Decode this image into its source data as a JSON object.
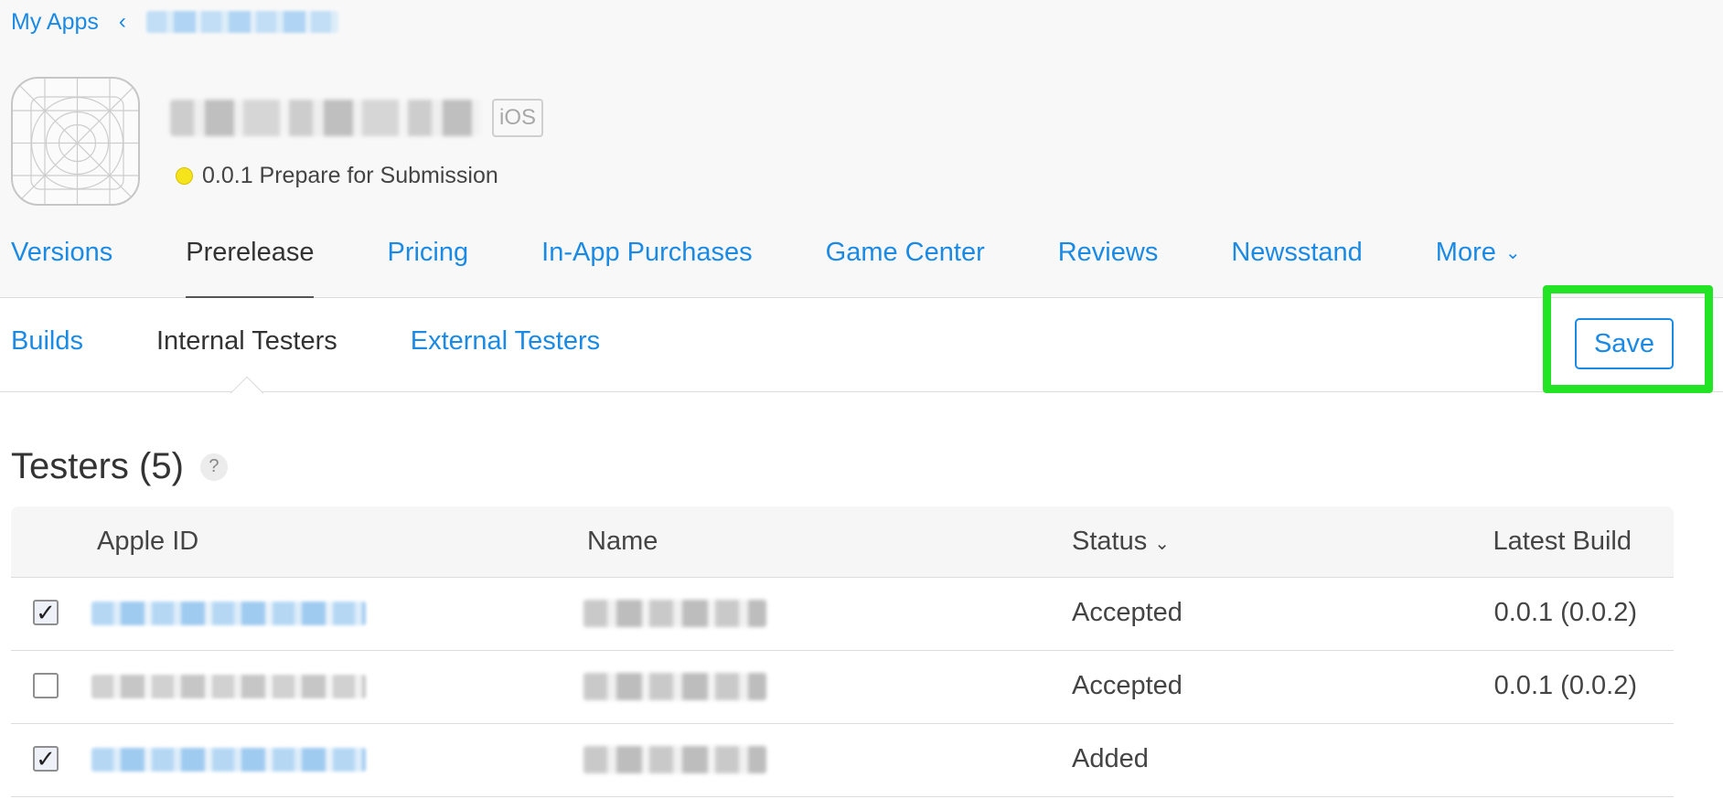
{
  "breadcrumb": {
    "root_label": "My Apps",
    "back_chevron": "‹"
  },
  "app": {
    "platform": "iOS",
    "status_text": "0.0.1 Prepare for Submission",
    "status_color": "#f5e31c"
  },
  "main_tabs": [
    {
      "label": "Versions"
    },
    {
      "label": "Prerelease"
    },
    {
      "label": "Pricing"
    },
    {
      "label": "In-App Purchases"
    },
    {
      "label": "Game Center"
    },
    {
      "label": "Reviews"
    },
    {
      "label": "Newsstand"
    },
    {
      "label": "More"
    }
  ],
  "sub_tabs": [
    {
      "label": "Builds"
    },
    {
      "label": "Internal Testers"
    },
    {
      "label": "External Testers"
    }
  ],
  "toolbar": {
    "save_label": "Save",
    "highlight_color": "#22e324"
  },
  "testers": {
    "title": "Testers (5)",
    "help_label": "?",
    "columns": {
      "apple_id": "Apple ID",
      "name": "Name",
      "status": "Status",
      "latest_build": "Latest Build"
    },
    "rows": [
      {
        "checked": true,
        "status": "Accepted",
        "latest_build": "0.0.1 (0.0.2)"
      },
      {
        "checked": false,
        "status": "Accepted",
        "latest_build": "0.0.1 (0.0.2)"
      },
      {
        "checked": true,
        "status": "Added",
        "latest_build": ""
      }
    ]
  },
  "colors": {
    "link": "#1a8ae5",
    "text": "#333333"
  }
}
